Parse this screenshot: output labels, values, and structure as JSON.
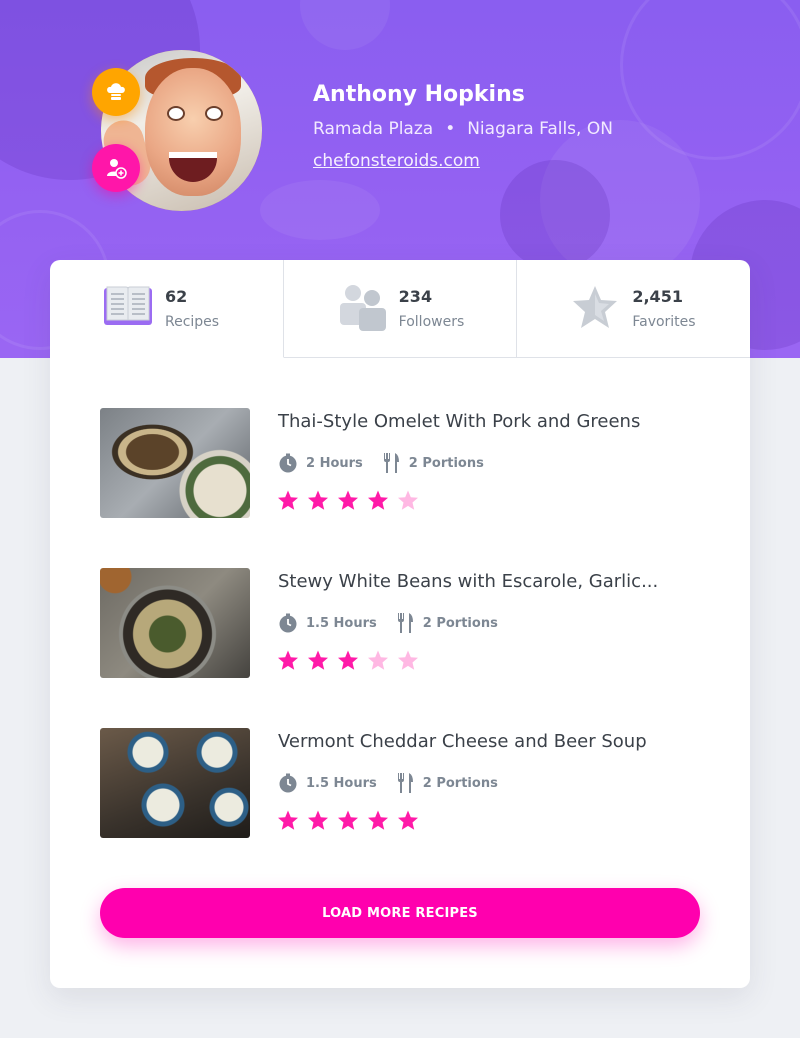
{
  "profile": {
    "name": "Anthony Hopkins",
    "location": "Ramada Plaza",
    "city": "Niagara Falls, ON",
    "separator": "•",
    "website": "chefonsteroids.com"
  },
  "stats": [
    {
      "value": "62",
      "label": "Recipes",
      "icon": "book-icon"
    },
    {
      "value": "234",
      "label": "Followers",
      "icon": "followers-icon"
    },
    {
      "value": "2,451",
      "label": "Favorites",
      "icon": "star-icon"
    }
  ],
  "recipes": [
    {
      "title": "Thai-Style Omelet With Pork and Greens",
      "time": "2 Hours",
      "portions": "2 Portions",
      "rating": 4
    },
    {
      "title": "Stewy White Beans with Escarole, Garlic...",
      "time": "1.5 Hours",
      "portions": "2 Portions",
      "rating": 3
    },
    {
      "title": "Vermont Cheddar Cheese and Beer Soup",
      "time": "1.5 Hours",
      "portions": "2 Portions",
      "rating": 5
    }
  ],
  "load_more_label": "LOAD MORE RECIPES",
  "colors": {
    "accent": "#ff00ae",
    "hero": "#9361f2",
    "chef_badge": "#ffa500",
    "star_on": "#ff1aa8",
    "star_off": "#ffb8e3"
  }
}
